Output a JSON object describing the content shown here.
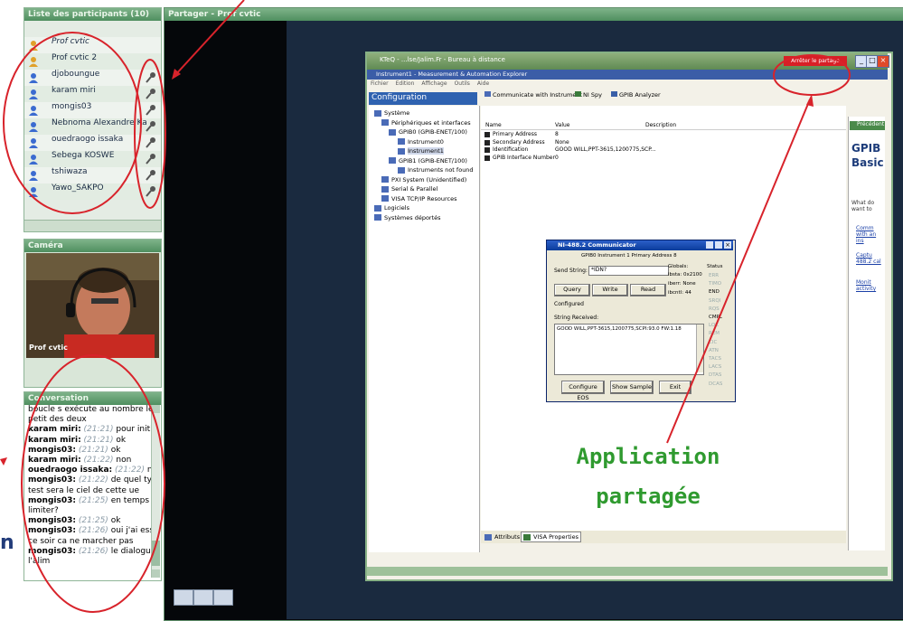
{
  "participants_panel": {
    "title": "Liste des participants (10)",
    "participants": [
      {
        "name": "Prof cvtic",
        "role": "moderator"
      },
      {
        "name": "Prof cvtic 2",
        "role": "moderator"
      },
      {
        "name": "djoboungue",
        "role": "participant"
      },
      {
        "name": "karam miri",
        "role": "participant"
      },
      {
        "name": "mongis03",
        "role": "participant"
      },
      {
        "name": "Nebnoma Alexandre Ka",
        "role": "participant"
      },
      {
        "name": "ouedraogo issaka",
        "role": "participant"
      },
      {
        "name": "Sebega KOSWE",
        "role": "participant"
      },
      {
        "name": "tshiwaza",
        "role": "participant"
      },
      {
        "name": "Yawo_SAKPO",
        "role": "participant"
      }
    ]
  },
  "camera_panel": {
    "title": "Caméra",
    "speaker": "Prof cvtic"
  },
  "chat_panel": {
    "title": "Conversation",
    "messages": [
      {
        "author": "",
        "time": "",
        "text": "boucle s exécute au nombre le plus petit des deux"
      },
      {
        "author": "karam miri:",
        "time": "(21:21)",
        "text": "pour initialisé"
      },
      {
        "author": "karam miri:",
        "time": "(21:21)",
        "text": "ok"
      },
      {
        "author": "mongis03:",
        "time": "(21:21)",
        "text": "ok"
      },
      {
        "author": "karam miri:",
        "time": "(21:22)",
        "text": "non"
      },
      {
        "author": "ouedraogo issaka:",
        "time": "(21:22)",
        "text": "non"
      },
      {
        "author": "mongis03:",
        "time": "(21:22)",
        "text": "de quel type de test sera le ciel de cette ue"
      },
      {
        "author": "mongis03:",
        "time": "(21:25)",
        "text": "en temps limiter?"
      },
      {
        "author": "mongis03:",
        "time": "(21:25)",
        "text": "ok"
      },
      {
        "author": "mongis03:",
        "time": "(21:26)",
        "text": "oui j'ai essayer ce soir ca ne marcher pas"
      },
      {
        "author": "mongis03:",
        "time": "(21:26)",
        "text": "le dialogue avec l'alim"
      }
    ]
  },
  "share_panel": {
    "title": "Partager - Prof cvtic"
  },
  "shared_app": {
    "window_title": "KTeQ - ...lse/Jalim.Fr - Bureau à distance",
    "mae_title": "Instrument1 - Measurement & Automation Explorer",
    "stop_sharing": "Arrêter le partage",
    "menu": [
      "Fichier",
      "Edition",
      "Affichage",
      "Outils",
      "Aide"
    ],
    "toolbar": [
      "Communicate with Instrument",
      "NI Spy",
      "GPIB Analyzer"
    ],
    "config_header": "Configuration",
    "tree": [
      "Système",
      "Périphériques et interfaces",
      "GPIB0 (GPIB-ENET/100)",
      "Instrument0",
      "Instrument1",
      "GPIB1 (GPIB-ENET/100)",
      "Instruments not found",
      "PXI System (Unidentified)",
      "Serial & Parallel",
      "VISA TCP/IP Resources",
      "Logiciels",
      "Systèmes déportés"
    ],
    "table_headers": [
      "Name",
      "Value",
      "Description"
    ],
    "table_rows": [
      {
        "name": "Primary Address",
        "value": "8"
      },
      {
        "name": "Secondary Address",
        "value": "None"
      },
      {
        "name": "Identification",
        "value": "GOOD WILL,PPT-3615,1200775,SCP..."
      },
      {
        "name": "GPIB Interface Number",
        "value": "0"
      }
    ],
    "bottom_tabs": [
      "Attributs",
      "VISA Properties"
    ],
    "right_panel": {
      "previous": "Précédent",
      "heading_1": "GPIB",
      "heading_2": "Basic",
      "body": "What do want to",
      "links": [
        "Comm with an ins",
        "Captu 488.2 cal",
        "Monit activity"
      ]
    }
  },
  "communicator": {
    "title": "NI-488.2 Communicator",
    "info": "GPIB0   Instrument 1   Primary Address 8",
    "send_label": "Send String:",
    "send_value": "*IDN?",
    "globals_label": "Globals:",
    "ibsta": "ibsta: 0x2100",
    "iberr": "iberr: None",
    "ibcntl": "ibcntl: 44",
    "status_label": "Status",
    "status_flags": [
      "ERR",
      "TIMO",
      "END",
      "SRQI",
      "RQS",
      "CMPL",
      "LOK",
      "REM",
      "CIC",
      "ATN",
      "TACS",
      "LACS",
      "DTAS",
      "DCAS"
    ],
    "query": "Query",
    "write": "Write",
    "read": "Read",
    "configured": "Configured",
    "received_label": "String Received:",
    "received_value": "GOOD WILL,PPT-3615,1200775,SCPI:93.0 FW:1.18",
    "configure_eos": "Configure EOS",
    "show_sample": "Show Sample",
    "exit": "Exit"
  },
  "annotation": {
    "line1": "Application",
    "line2": "partagée",
    "color": "#2f9a2f"
  },
  "colors": {
    "panel_header": "#5f9b6b",
    "annotation_red": "#d8232b",
    "dark_bg": "#05070a"
  }
}
